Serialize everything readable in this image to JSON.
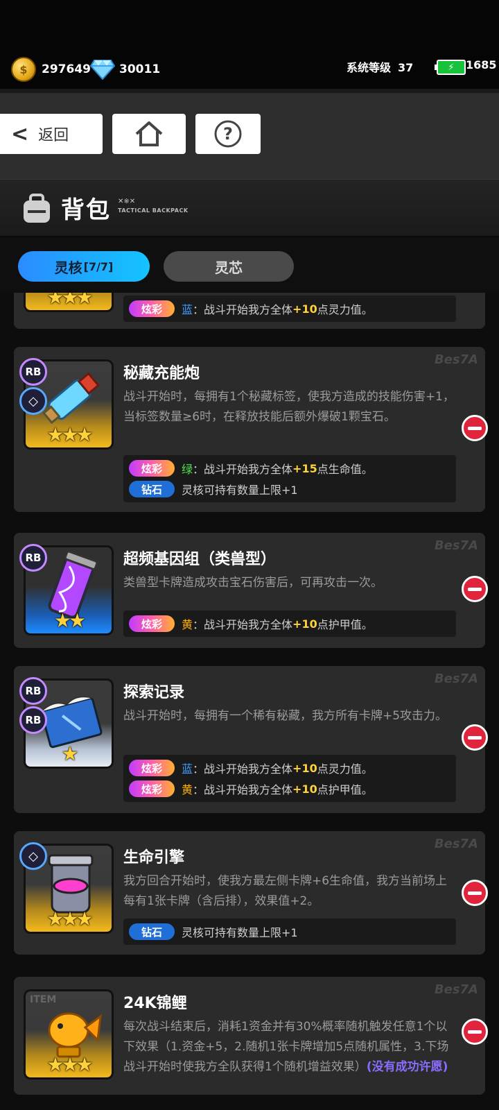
{
  "header": {
    "coins": "297649",
    "gems": "30011",
    "system_level_label": "系统等级",
    "system_level": "37",
    "energy": "1685"
  },
  "nav": {
    "back_label": "返回",
    "back_arrow": "<"
  },
  "page": {
    "title": "背包",
    "subtitle": "TACTICAL BACKPACK",
    "subtitle_mark": "✕※✕"
  },
  "tabs": [
    {
      "label": "灵核",
      "count": "[7/7]",
      "active": true
    },
    {
      "label": "灵芯",
      "active": false
    }
  ],
  "watermark": "Bes7A",
  "items": [
    {
      "name": "",
      "stars": "★★★",
      "effects": [
        {
          "tag": "炫彩",
          "color_label": "蓝",
          "pre": "：战斗开始我方全体",
          "value": "+10",
          "post": "点灵力值。"
        }
      ]
    },
    {
      "name": "秘藏充能炮",
      "stars": "★★★",
      "badges": [
        "RB",
        "◇"
      ],
      "desc": "战斗开始时，每拥有1个秘藏标签，使我方造成的技能伤害+1，当标签数量≥6时，在释放技能后额外爆破1颗宝石。",
      "effects": [
        {
          "tag": "炫彩",
          "color_label": "绿",
          "pre": "：战斗开始我方全体",
          "value": "+15",
          "post": "点生命值。"
        },
        {
          "tag": "钻石",
          "text": "灵核可持有数量上限+1"
        }
      ]
    },
    {
      "name": "超频基因组（类兽型）",
      "stars": "★★",
      "badges": [
        "RB"
      ],
      "desc": "类兽型卡牌造成攻击宝石伤害后，可再攻击一次。",
      "effects": [
        {
          "tag": "炫彩",
          "color_label": "黄",
          "pre": "：战斗开始我方全体",
          "value": "+10",
          "post": "点护甲值。"
        }
      ]
    },
    {
      "name": "探索记录",
      "stars": "★",
      "badges": [
        "RB",
        "RB"
      ],
      "desc": "战斗开始时，每拥有一个稀有秘藏，我方所有卡牌+5攻击力。",
      "effects": [
        {
          "tag": "炫彩",
          "color_label": "蓝",
          "pre": "：战斗开始我方全体",
          "value": "+10",
          "post": "点灵力值。"
        },
        {
          "tag": "炫彩",
          "color_label": "黄",
          "pre": "：战斗开始我方全体",
          "value": "+10",
          "post": "点护甲值。"
        }
      ]
    },
    {
      "name": "生命引擎",
      "stars": "★★★",
      "badges": [
        "◇"
      ],
      "desc": "我方回合开始时，使我方最左侧卡牌+6生命值，我方当前场上每有1张卡牌（含后排），效果值+2。",
      "effects": [
        {
          "tag": "钻石",
          "text": "灵核可持有数量上限+1"
        }
      ]
    },
    {
      "name": "24K锦鲤",
      "stars": "★★★",
      "thumb_label": "ITEM",
      "desc": "每次战斗结束后，消耗1资金并有30%概率随机触发任意1个以下效果（1.资金+5，2.随机1张卡牌增加5点随机属性，3.下场战斗开始时使我方全队获得1个随机增益效果）",
      "note": "(没有成功许愿)"
    }
  ]
}
